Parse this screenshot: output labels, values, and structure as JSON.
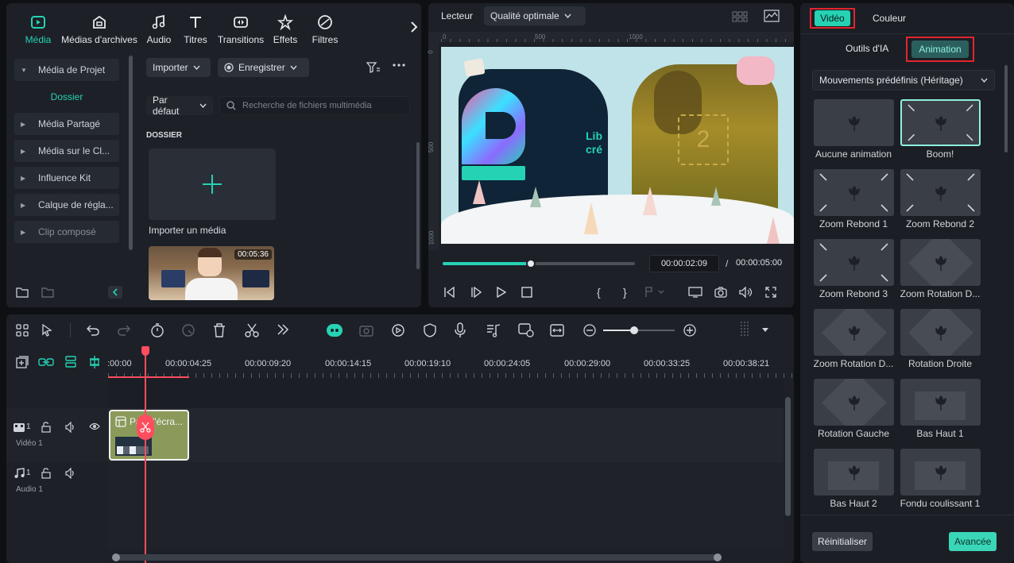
{
  "colors": {
    "accent": "#25d2b4",
    "highlight_box": "#e0262e",
    "playhead": "#ff4d5e",
    "clip_bg": "#8b9a5a"
  },
  "media_tabs": [
    {
      "label": "Média",
      "icon": "media-icon"
    },
    {
      "label": "Médias d'archives",
      "icon": "archive-icon"
    },
    {
      "label": "Audio",
      "icon": "music-note-icon"
    },
    {
      "label": "Titres",
      "icon": "text-icon"
    },
    {
      "label": "Transitions",
      "icon": "transitions-icon"
    },
    {
      "label": "Effets",
      "icon": "effects-icon"
    },
    {
      "label": "Filtres",
      "icon": "filters-icon"
    }
  ],
  "sidebar": {
    "items": [
      {
        "label": "Média de Projet"
      },
      {
        "label": "Dossier"
      },
      {
        "label": "Média Partagé"
      },
      {
        "label": "Média sur le Cl..."
      },
      {
        "label": "Influence Kit"
      },
      {
        "label": "Calque de régla..."
      },
      {
        "label": "Clip composé"
      }
    ]
  },
  "media_toolbar": {
    "import_label": "Importer",
    "record_label": "Enregistrer",
    "sort_label": "Par défaut",
    "search_placeholder": "Recherche de fichiers multimédia"
  },
  "media_content": {
    "section_title": "DOSSIER",
    "import_tile_label": "Importer un média",
    "clip_duration": "00:05:36"
  },
  "player": {
    "label": "Lecteur",
    "quality": "Qualité optimale",
    "ruler_top": [
      "0",
      "500",
      "1000"
    ],
    "ruler_left": [
      "0",
      "500",
      "1000"
    ],
    "preview_text": [
      "Lib",
      "cré"
    ],
    "current_time": "00:00:02:09",
    "separator": "/",
    "total_time": "00:00:05:00",
    "progress": 0.46
  },
  "timeline": {
    "timecodes": [
      ":00:00",
      "00:00:04:25",
      "00:00:09:20",
      "00:00:14:15",
      "00:00:19:10",
      "00:00:24:05",
      "00:00:29:00",
      "00:00:33:25",
      "00:00:38:21"
    ],
    "video_track": {
      "number": "1",
      "name": "Vidéo 1",
      "clip_title": "Pa   d'écra..."
    },
    "audio_track": {
      "number": "1",
      "name": "Audio 1"
    },
    "zoom_level": 0.43
  },
  "props": {
    "tabs": [
      "Vidéo",
      "Couleur"
    ],
    "subtabs": [
      "Outils d'IA",
      "Animation"
    ],
    "preset_dropdown": "Mouvements prédéfinis (Héritage)",
    "presets": [
      {
        "label": "Aucune animation"
      },
      {
        "label": "Boom!"
      },
      {
        "label": "Zoom Rebond 1"
      },
      {
        "label": "Zoom Rebond 2"
      },
      {
        "label": "Zoom Rebond 3"
      },
      {
        "label": "Zoom Rotation D..."
      },
      {
        "label": "Zoom Rotation D..."
      },
      {
        "label": "Rotation Droite"
      },
      {
        "label": "Rotation Gauche"
      },
      {
        "label": "Bas Haut 1"
      },
      {
        "label": "Bas Haut 2"
      },
      {
        "label": "Fondu coulissant 1"
      }
    ],
    "reset_label": "Réinitialiser",
    "advanced_label": "Avancée"
  }
}
